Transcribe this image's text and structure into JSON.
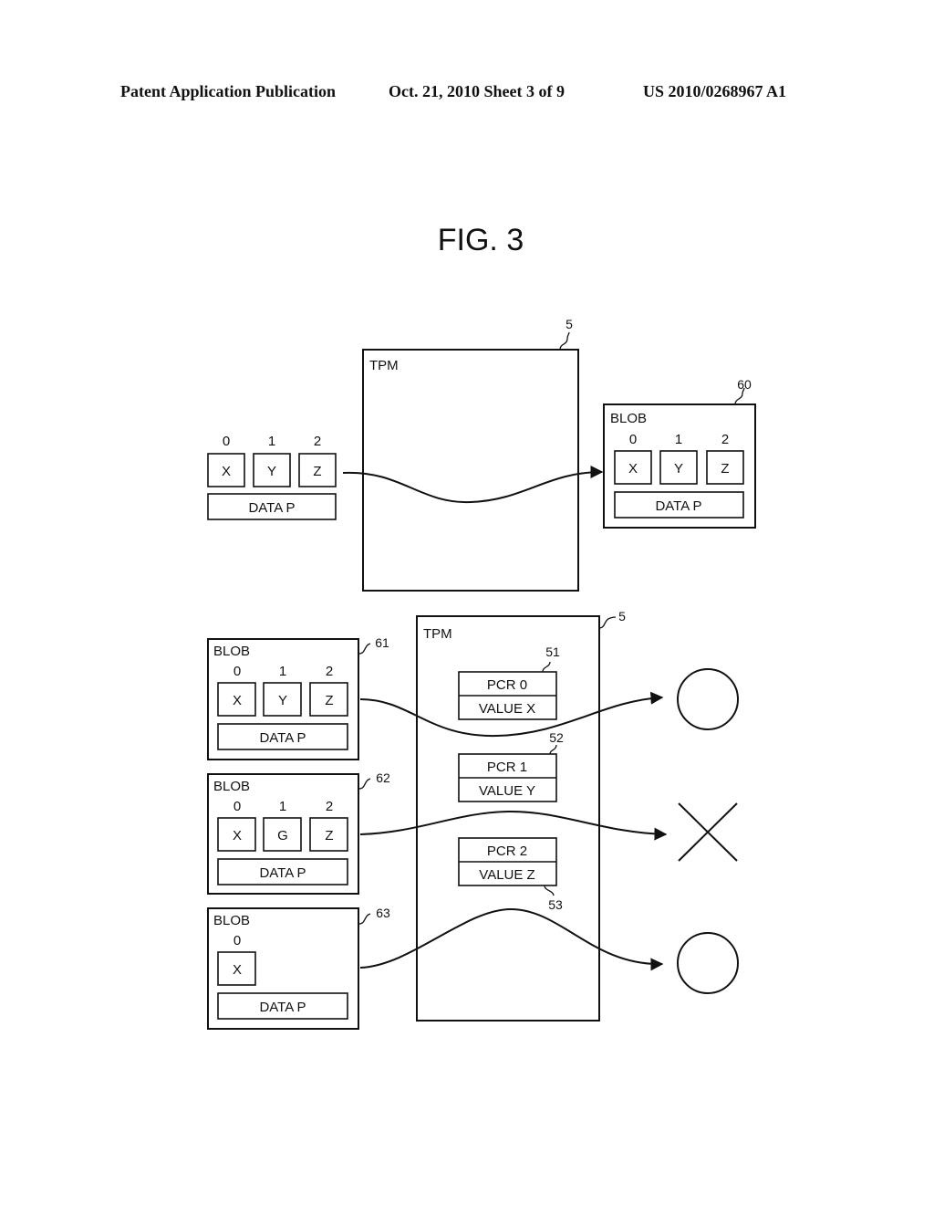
{
  "header": {
    "publication": "Patent Application Publication",
    "date_sheet": "Oct. 21, 2010   Sheet 3 of 9",
    "number": "US 2010/0268967 A1"
  },
  "figure": {
    "title": "FIG. 3"
  },
  "top": {
    "input": {
      "indices": [
        "0",
        "1",
        "2"
      ],
      "cells": [
        "X",
        "Y",
        "Z"
      ],
      "data": "DATA P"
    },
    "tpm": {
      "label": "TPM",
      "ref": "5"
    },
    "output_blob": {
      "label": "BLOB",
      "ref": "60",
      "indices": [
        "0",
        "1",
        "2"
      ],
      "cells": [
        "X",
        "Y",
        "Z"
      ],
      "data": "DATA P"
    }
  },
  "bottom": {
    "tpm": {
      "label": "TPM",
      "ref": "5",
      "pcrs": [
        {
          "name": "PCR 0",
          "value": "VALUE X",
          "ref": "51"
        },
        {
          "name": "PCR 1",
          "value": "VALUE Y",
          "ref": "52"
        },
        {
          "name": "PCR 2",
          "value": "VALUE Z",
          "ref": "53"
        }
      ]
    },
    "blobs": [
      {
        "label": "BLOB",
        "ref": "61",
        "indices": [
          "0",
          "1",
          "2"
        ],
        "cells": [
          "X",
          "Y",
          "Z"
        ],
        "data": "DATA P",
        "result": "circle"
      },
      {
        "label": "BLOB",
        "ref": "62",
        "indices": [
          "0",
          "1",
          "2"
        ],
        "cells": [
          "X",
          "G",
          "Z"
        ],
        "data": "DATA P",
        "result": "cross"
      },
      {
        "label": "BLOB",
        "ref": "63",
        "indices": [
          "0"
        ],
        "cells": [
          "X"
        ],
        "data": "DATA P",
        "result": "circle"
      }
    ]
  }
}
